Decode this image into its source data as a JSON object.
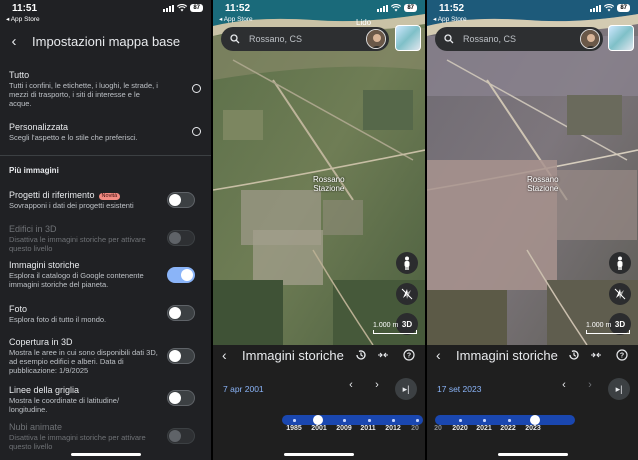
{
  "left": {
    "status": {
      "time": "11:51",
      "back_app": "◂ App Store",
      "battery": "87"
    },
    "header": {
      "title": "Impostazioni mappa base"
    },
    "options": [
      {
        "title": "Tutto",
        "desc": "Tutti i confini, le etichette, i luoghi, le strade, i mezzi di trasporto, i siti di interesse e le acque."
      },
      {
        "title": "Personalizzata",
        "desc": "Scegli l'aspetto e lo stile che preferisci."
      }
    ],
    "section_title": "Più immagini",
    "toggles": [
      {
        "title": "Progetti di riferimento",
        "badge": "Novità",
        "desc": "Sovrapponi i dati dei progetti esistenti",
        "state": "off"
      },
      {
        "title": "Edifici in 3D",
        "desc": "Disattiva le immagini storiche per attivare questo livello",
        "state": "disabled"
      },
      {
        "title": "Immagini storiche",
        "desc": "Esplora il catalogo di Google contenente immagini storiche del pianeta.",
        "state": "on"
      },
      {
        "title": "Foto",
        "desc": "Esplora foto di tutto il mondo.",
        "state": "off"
      },
      {
        "title": "Copertura in 3D",
        "desc": "Mostra le aree in cui sono disponibili dati 3D, ad esempio edifici e alberi. Data di pubblicazione: 1/9/2025",
        "state": "off"
      },
      {
        "title": "Linee della griglia",
        "desc": "Mostra le coordinate di latitudine/ longitudine.",
        "state": "off"
      },
      {
        "title": "Nubi animate",
        "desc": "Disattiva le immagini storiche per attivare questo livello",
        "state": "disabled"
      }
    ]
  },
  "mid": {
    "status": {
      "time": "11:52",
      "back_app": "◂ App Store",
      "battery": "87"
    },
    "search_text": "Rossano, CS",
    "place_top": "Lido",
    "place_label": "Rossano\nStazione",
    "scale_text": "1.000 m",
    "button_3d": "3D",
    "history_title": "Immagini storiche",
    "date": "7 apr 2001",
    "years": [
      "1985",
      "2001",
      "2009",
      "2011",
      "2012",
      "20"
    ]
  },
  "right": {
    "status": {
      "time": "11:52",
      "back_app": "◂ App Store",
      "battery": "87"
    },
    "search_text": "Rossano, CS",
    "place_label": "Rossano\nStazione",
    "scale_text": "1.000 m",
    "button_3d": "3D",
    "history_title": "Immagini storiche",
    "date": "17 set 2023",
    "years": [
      "20",
      "2020",
      "2021",
      "2022",
      "2023"
    ]
  },
  "colors": {
    "accent": "#8ab4f8",
    "toggle_on": "#8ab4f8",
    "badge": "#f28b82",
    "timeline": "#1a47b0"
  }
}
